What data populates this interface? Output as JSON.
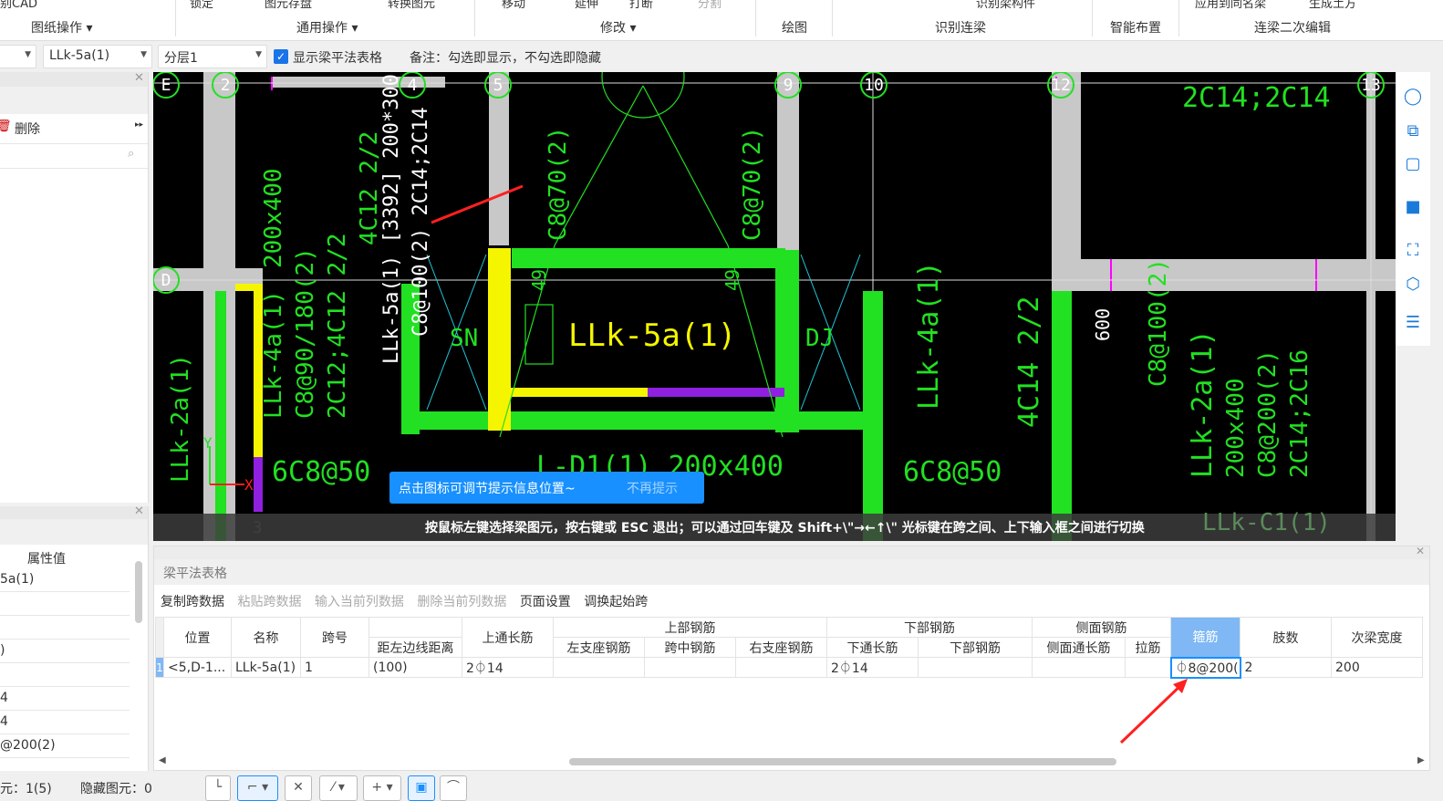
{
  "ribbon": {
    "top_items": [
      "别CAD",
      "锁定",
      "图元存盘",
      "转换图元",
      "移动",
      "延伸",
      "打断",
      "分割",
      "识别梁构件",
      "应用到同名梁",
      "生成土方"
    ],
    "groups": [
      "图纸操作",
      "通用操作",
      "修改",
      "绘图",
      "识别连梁",
      "智能布置",
      "连梁二次编辑"
    ]
  },
  "toolbar": {
    "beam_select": "LLk-5a(1)",
    "layer_select": "分层1",
    "show_table_label": "显示梁平法表格",
    "show_table_checked": true,
    "note": "备注：勾选即显示，不勾选即隐藏"
  },
  "left_panel": {
    "delete_label": "删除",
    "prop_header": "属性值",
    "prop_values": [
      "5a(1)",
      "",
      "",
      ")",
      "",
      "4",
      "4",
      "@200(2)"
    ]
  },
  "cad": {
    "grid_labels": [
      "E",
      "2",
      "4",
      "5",
      "9",
      "10",
      "12",
      "13",
      "D",
      "3"
    ],
    "texts": [
      "LLk-5a(1) [3392] 200*300",
      "C8@100(2) 2C14;2C14",
      "C8@70(2)",
      "C8@70(2)",
      "490",
      "490",
      "LLk-5a(1)",
      "SN",
      "DJ",
      "200x400",
      "LLk-4a(1)",
      "C8@90/180(2)",
      "2C12;4C12 2/2",
      "4C12 2/2",
      "LLk-2a(1)",
      "6C8@50",
      "6C8@50",
      "L-D1(1) 200x400",
      "LLk-4a(1)",
      "4C14 2/2",
      "600",
      "C8@100(2)",
      "LLk-2a(1)",
      "200x400",
      "C8@200(2)",
      "2C14;2C16",
      "2C14;2C14",
      "LLk-C1(1)",
      "Y",
      "X"
    ],
    "tooltip": "点击图标可调节提示信息位置~",
    "tooltip_dismiss": "不再提示",
    "status": "按鼠标左键选择梁图元，按右键或 ESC 退出；可以通过回车键及 Shift+\\\"→←↑\\\" 光标键在跨之间、上下输入框之间进行切换"
  },
  "beam_table": {
    "title": "梁平法表格",
    "actions": [
      "复制跨数据",
      "粘贴跨数据",
      "输入当前列数据",
      "删除当前列数据",
      "页面设置",
      "调换起始跨"
    ],
    "group_headers": [
      "上部钢筋",
      "下部钢筋",
      "侧面钢筋"
    ],
    "headers": [
      "位置",
      "名称",
      "跨号",
      "距左边线距离",
      "上通长筋",
      "左支座钢筋",
      "跨中钢筋",
      "右支座钢筋",
      "下通长筋",
      "下部钢筋",
      "侧面通长筋",
      "拉筋",
      "箍筋",
      "肢数",
      "次梁宽度"
    ],
    "rows": [
      [
        "1",
        "<5,D-1...",
        "LLk-5a(1)",
        "1",
        "(100)",
        "2⏀14",
        "",
        "",
        "",
        "2⏀14",
        "",
        "",
        "",
        "⏀8@200(",
        "2",
        "200"
      ]
    ]
  },
  "statusbar": {
    "count": "元：1(5)",
    "hidden": "隐藏图元：0"
  },
  "colors": {
    "accent": "#1890ff",
    "selected_header": "#7fb8f5",
    "cad_bg": "#000000",
    "beam_green": "#22e022",
    "beam_yellow": "#f5f500"
  }
}
